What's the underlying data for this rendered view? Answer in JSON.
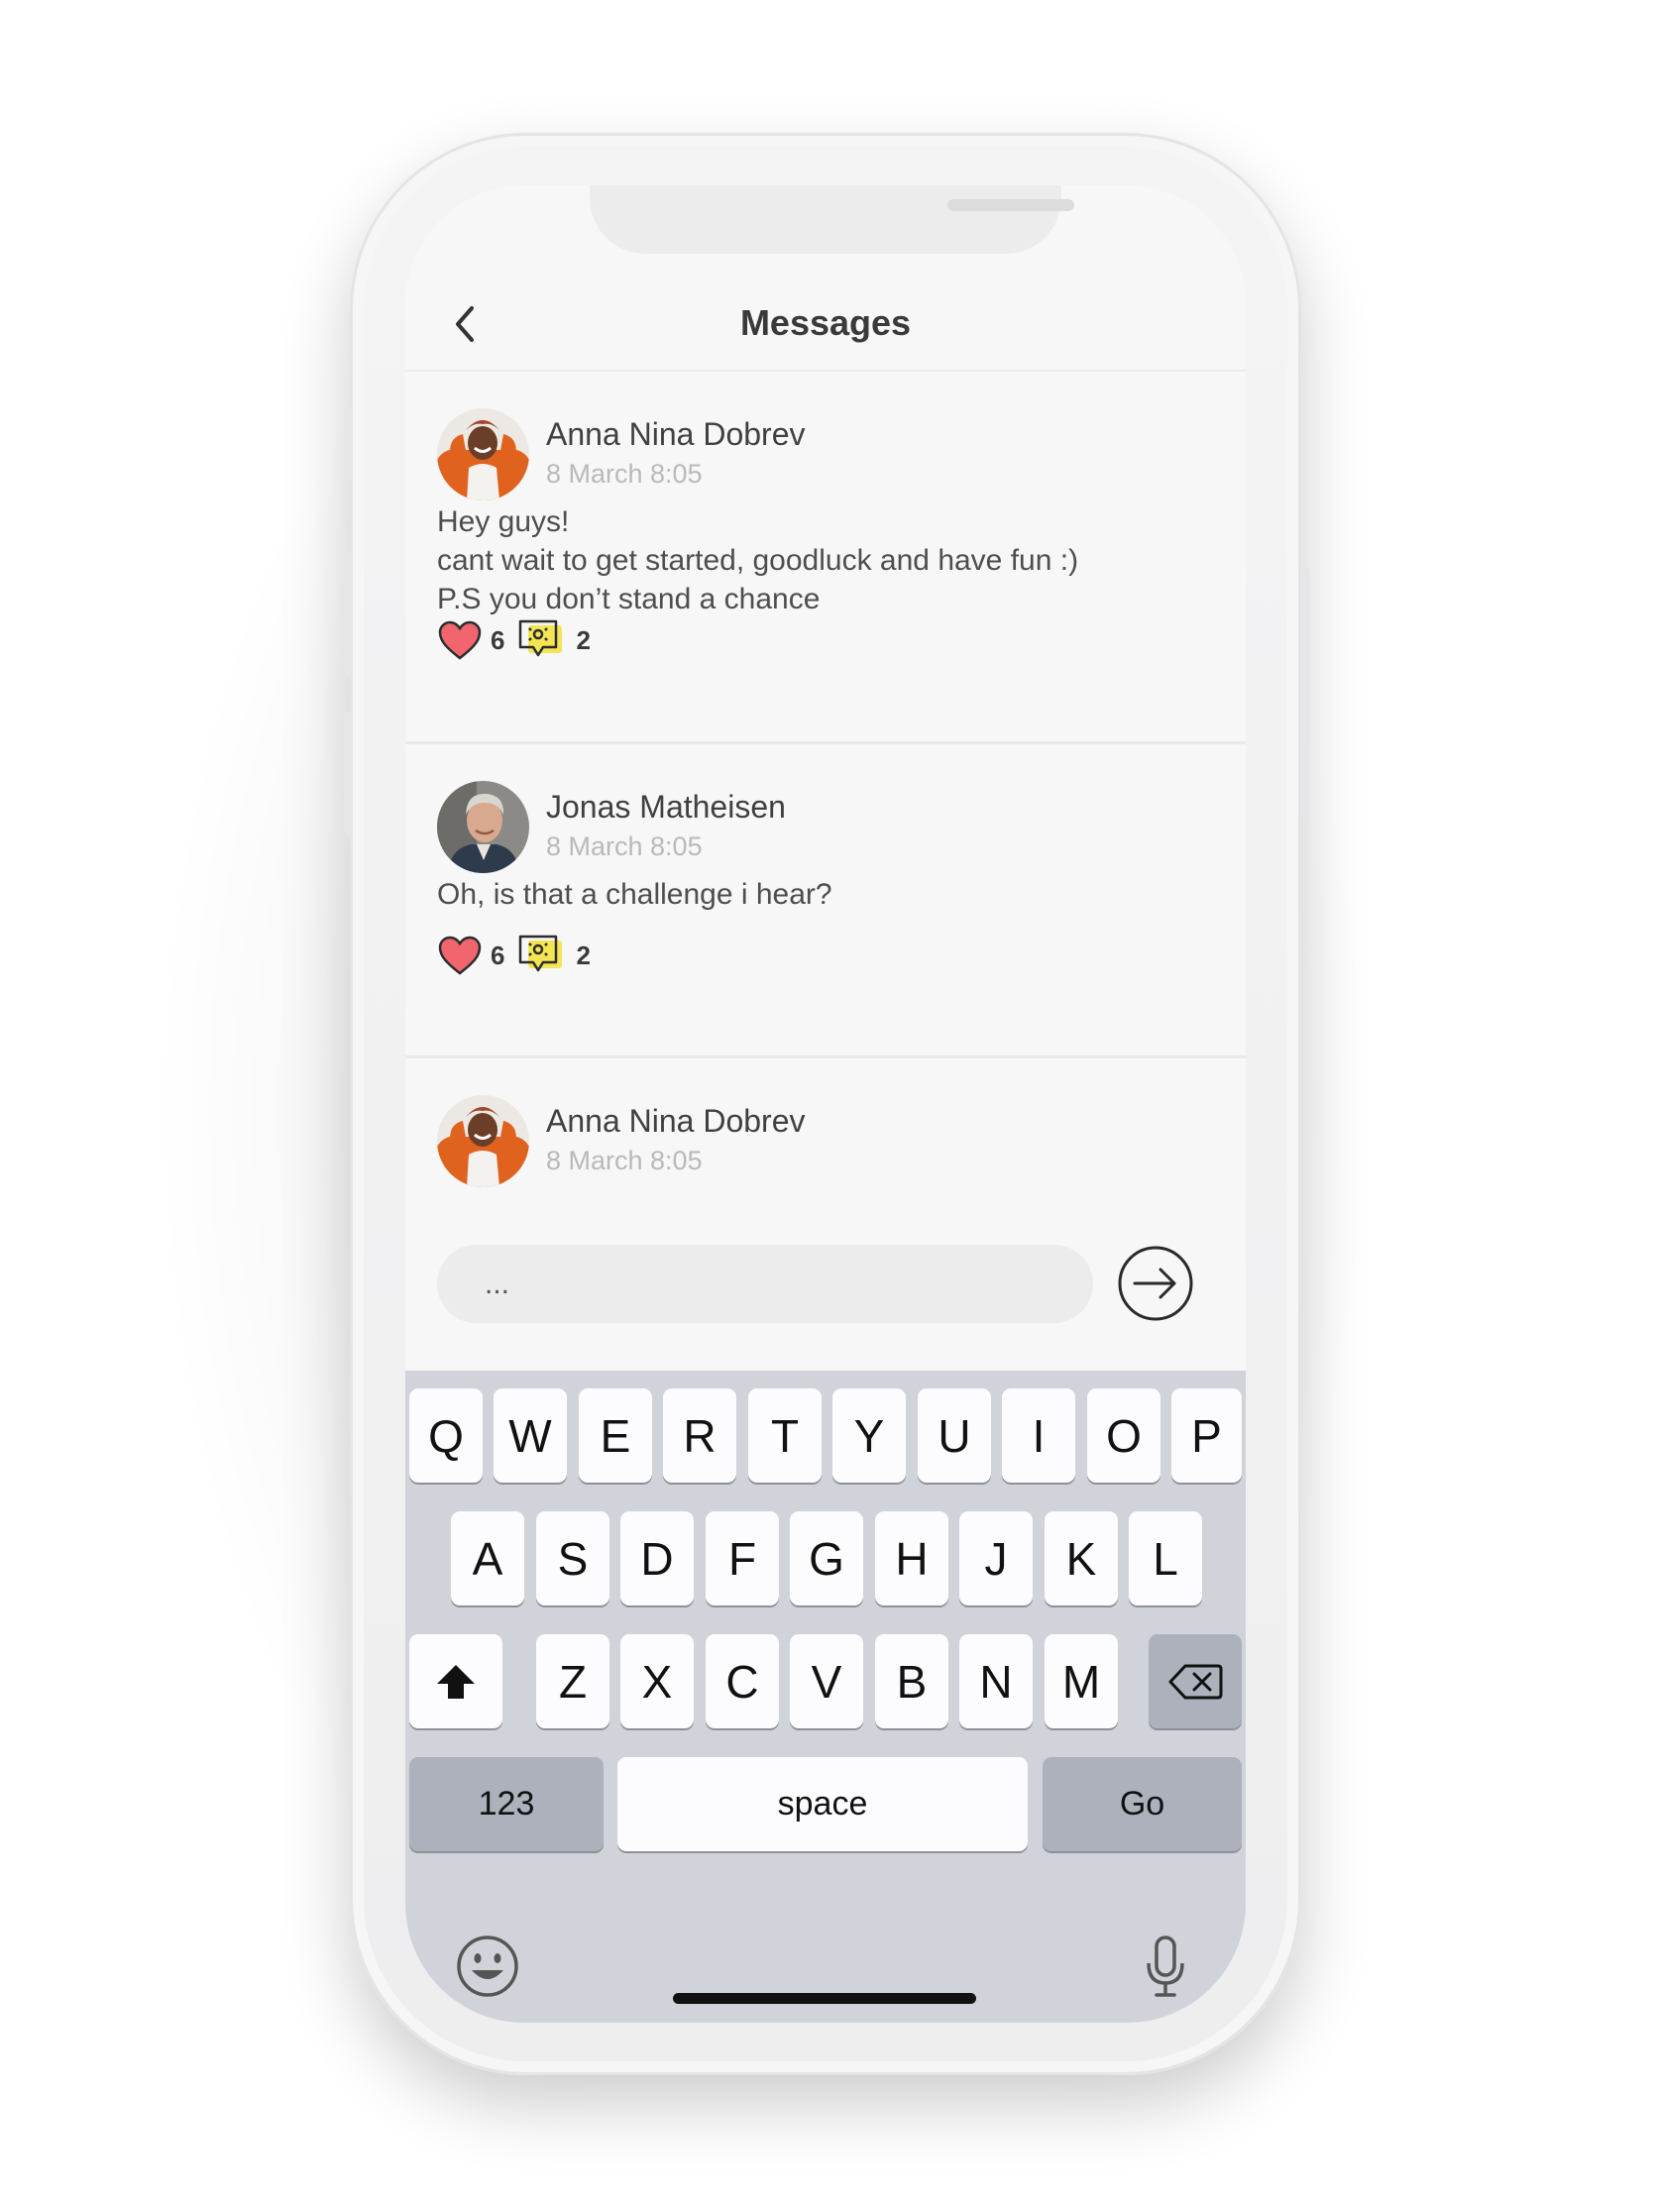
{
  "header": {
    "title": "Messages",
    "back_icon": "chevron-left-icon"
  },
  "posts": [
    {
      "author": "Anna Nina Dobrev",
      "time": "8 March 8:05",
      "lines": [
        "Hey guys!",
        "cant wait to get started, goodluck and have fun :)",
        "P.S you don’t stand a chance"
      ],
      "likes": "6",
      "comments": "2"
    },
    {
      "author": "Jonas Matheisen",
      "time": "8 March 8:05",
      "lines": [
        "Oh, is that a challenge i hear?"
      ],
      "likes": "6",
      "comments": "2"
    },
    {
      "author": "Anna Nina Dobrev",
      "time": "8 March 8:05"
    }
  ],
  "composer": {
    "placeholder": "...",
    "send_icon": "arrow-right-circle-icon"
  },
  "keyboard": {
    "row1": [
      "Q",
      "W",
      "E",
      "R",
      "T",
      "Y",
      "U",
      "I",
      "O",
      "P"
    ],
    "row2": [
      "A",
      "S",
      "D",
      "F",
      "G",
      "H",
      "J",
      "K",
      "L"
    ],
    "row3": [
      "Z",
      "X",
      "C",
      "V",
      "B",
      "N",
      "M"
    ],
    "numbers": "123",
    "space": "space",
    "go": "Go"
  },
  "colors": {
    "heart": "#f0656e",
    "comment_badge": "#f3e553",
    "screen_bg": "#f7f7f7",
    "keyboard_bg": "#d0d3d9"
  }
}
